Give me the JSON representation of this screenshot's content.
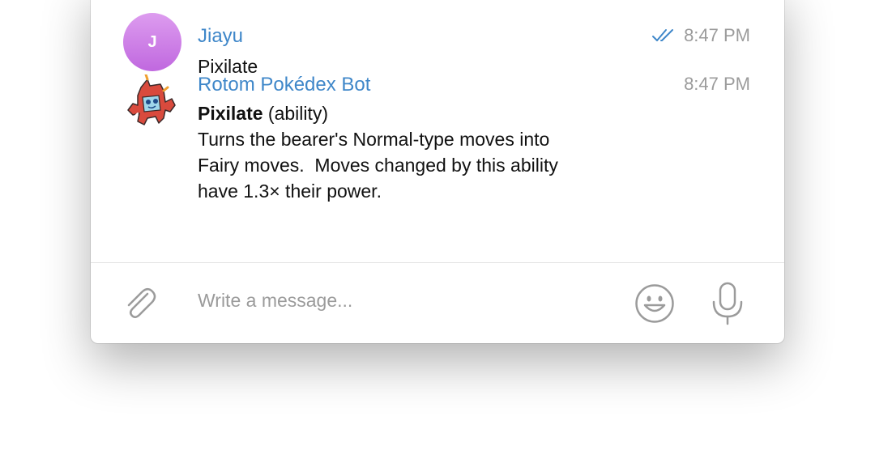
{
  "messages": [
    {
      "sender": "Jiayu",
      "avatar_initial": "J",
      "time": "8:47 PM",
      "read_status": "double-check-icon",
      "text": "Pixilate"
    },
    {
      "sender": "Rotom Pokédex Bot",
      "avatar_icon": "rotom-pokedex-avatar",
      "time": "8:47 PM",
      "title_bold": "Pixilate",
      "title_suffix": " (ability)",
      "lines": [
        "Turns the bearer's Normal-type moves into",
        "Fairy moves.  Moves changed by this ability",
        "have 1.3× their power."
      ]
    }
  ],
  "composer": {
    "placeholder": "Write a message...",
    "attach_icon": "paperclip-icon",
    "emoji_icon": "smiley-icon",
    "mic_icon": "microphone-icon"
  },
  "colors": {
    "sender_name": "#3f87c9",
    "timestamp": "#9b9b9b",
    "avatar_gradient_top": "#dd9cef",
    "avatar_gradient_bottom": "#c068df",
    "icon_gray": "#9b9b9b"
  }
}
